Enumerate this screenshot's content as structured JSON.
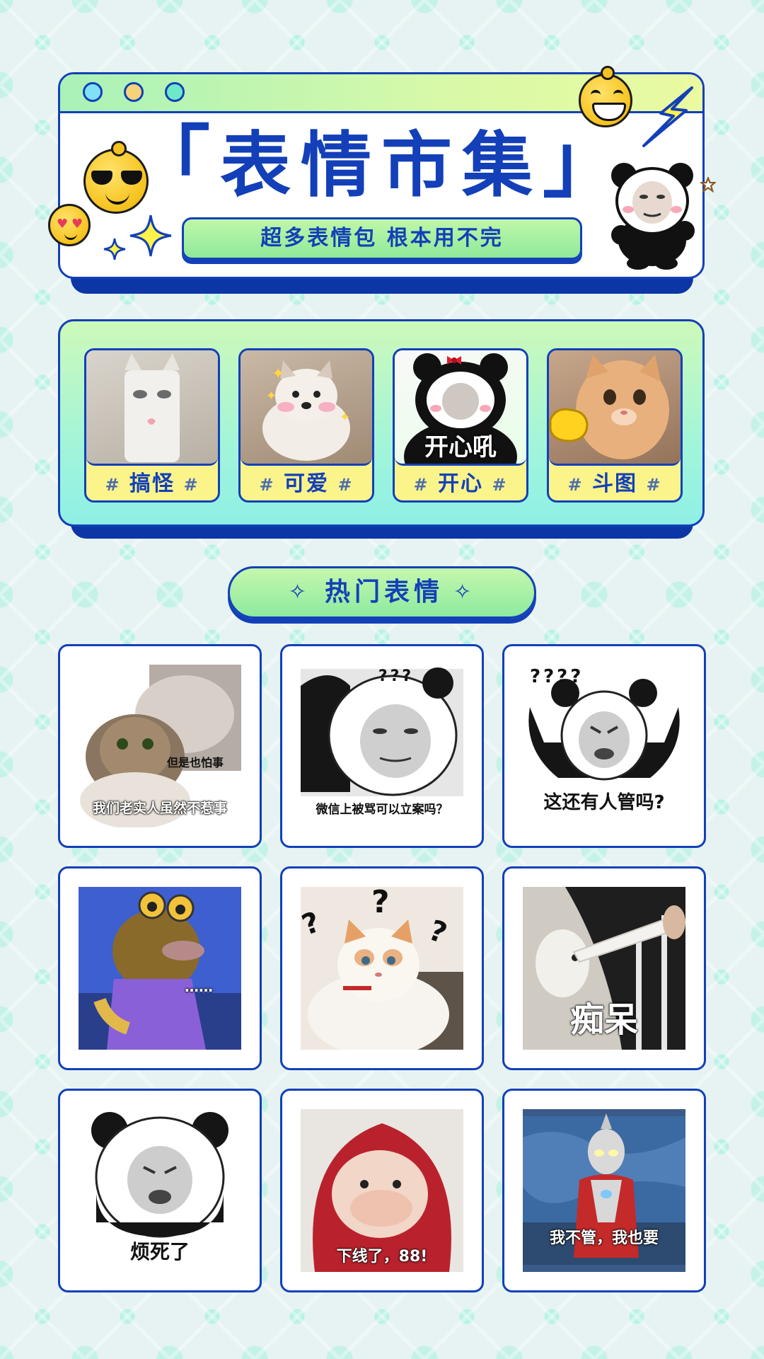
{
  "header": {
    "title": "表情市集",
    "bracket_open": "「",
    "bracket_close": "」",
    "subtitle": "超多表情包 根本用不完"
  },
  "categories": [
    {
      "label": "搞怪",
      "hash": "#"
    },
    {
      "label": "可爱",
      "hash": "#"
    },
    {
      "label": "开心",
      "hash": "#",
      "overlay": "开心吼"
    },
    {
      "label": "斗图",
      "hash": "#"
    }
  ],
  "section": {
    "title": "热门表情",
    "icon": "sparkle-icon"
  },
  "memes": [
    {
      "caption": "我们老实人虽然不惹事",
      "sub": "但是也怕事"
    },
    {
      "caption": "微信上被骂可以立案吗？",
      "marks": "???"
    },
    {
      "caption": "这还有人管吗?",
      "marks": "????"
    },
    {
      "caption": "……"
    },
    {
      "caption": ""
    },
    {
      "caption": "痴呆"
    },
    {
      "caption": "烦死了"
    },
    {
      "caption": "下线了，88!"
    },
    {
      "caption": "我不管，我也要"
    }
  ],
  "colors": {
    "primary": "#1340b8",
    "shadow": "#0c36a6",
    "accent_green": "#8deaa0",
    "accent_yellow": "#fbf48b",
    "mint": "#8ff0e6"
  }
}
